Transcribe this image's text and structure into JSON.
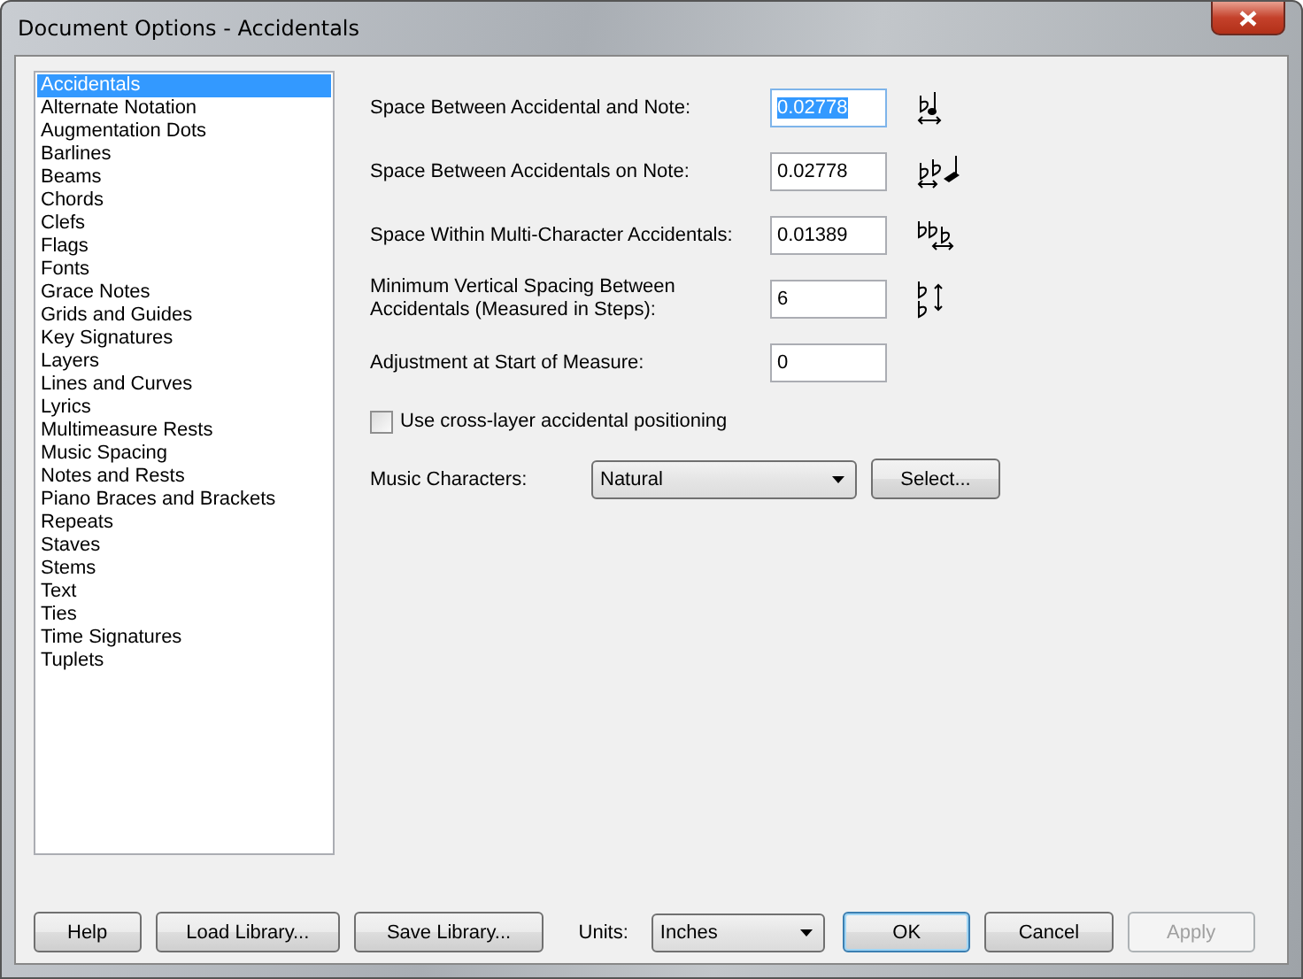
{
  "window": {
    "title": "Document Options - Accidentals"
  },
  "sidebar": {
    "items": [
      {
        "label": "Accidentals",
        "selected": true
      },
      {
        "label": "Alternate Notation",
        "selected": false
      },
      {
        "label": "Augmentation Dots",
        "selected": false
      },
      {
        "label": "Barlines",
        "selected": false
      },
      {
        "label": "Beams",
        "selected": false
      },
      {
        "label": "Chords",
        "selected": false
      },
      {
        "label": "Clefs",
        "selected": false
      },
      {
        "label": "Flags",
        "selected": false
      },
      {
        "label": "Fonts",
        "selected": false
      },
      {
        "label": "Grace Notes",
        "selected": false
      },
      {
        "label": "Grids and Guides",
        "selected": false
      },
      {
        "label": "Key Signatures",
        "selected": false
      },
      {
        "label": "Layers",
        "selected": false
      },
      {
        "label": "Lines and Curves",
        "selected": false
      },
      {
        "label": "Lyrics",
        "selected": false
      },
      {
        "label": "Multimeasure Rests",
        "selected": false
      },
      {
        "label": "Music Spacing",
        "selected": false
      },
      {
        "label": "Notes and Rests",
        "selected": false
      },
      {
        "label": "Piano Braces and Brackets",
        "selected": false
      },
      {
        "label": "Repeats",
        "selected": false
      },
      {
        "label": "Staves",
        "selected": false
      },
      {
        "label": "Stems",
        "selected": false
      },
      {
        "label": "Text",
        "selected": false
      },
      {
        "label": "Ties",
        "selected": false
      },
      {
        "label": "Time Signatures",
        "selected": false
      },
      {
        "label": "Tuplets",
        "selected": false
      }
    ]
  },
  "fields": [
    {
      "label": "Space Between Accidental and Note:",
      "value": "0.02778",
      "selected": true
    },
    {
      "label": "Space Between Accidentals on Note:",
      "value": "0.02778",
      "selected": false
    },
    {
      "label": "Space Within Multi-Character Accidentals:",
      "value": "0.01389",
      "selected": false
    },
    {
      "label": "Minimum Vertical Spacing Between Accidentals (Measured in Steps):",
      "value": "6",
      "selected": false
    },
    {
      "label": "Adjustment at Start of Measure:",
      "value": "0",
      "selected": false
    }
  ],
  "cross_layer": {
    "label": "Use cross-layer accidental positioning",
    "checked": false
  },
  "music_characters": {
    "label": "Music Characters:",
    "value": "Natural",
    "button": "Select..."
  },
  "footer": {
    "buttons_left": [
      "Help",
      "Load Library...",
      "Save Library..."
    ],
    "units_label": "Units:",
    "units_value": "Inches",
    "buttons_right": [
      {
        "label": "OK",
        "disabled": false,
        "default": true
      },
      {
        "label": "Cancel",
        "disabled": false,
        "default": false
      },
      {
        "label": "Apply",
        "disabled": true,
        "default": false
      }
    ]
  }
}
